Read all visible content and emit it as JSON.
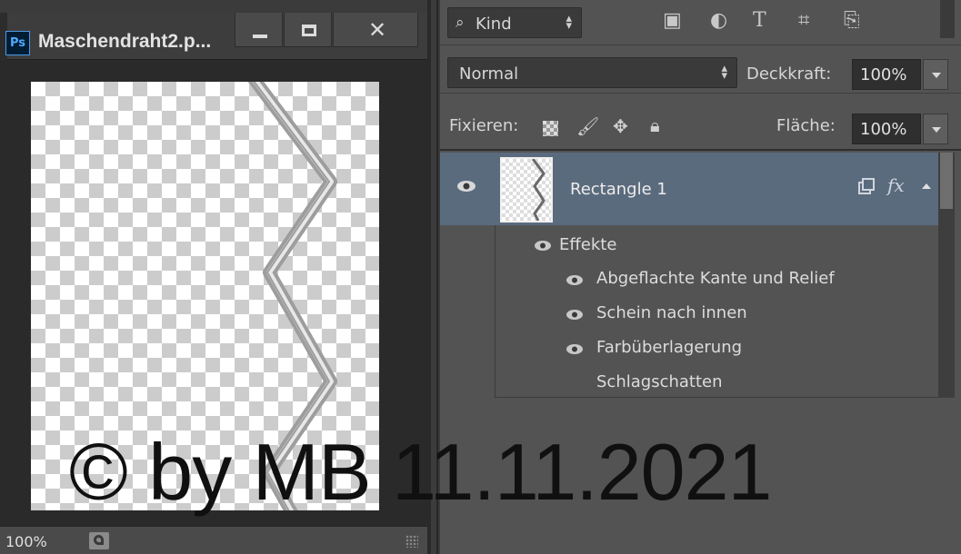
{
  "document": {
    "app_badge": "Ps",
    "title": "Maschendraht2.p...",
    "zoom": "100%"
  },
  "layers_panel": {
    "filter": {
      "kind_label": "Kind",
      "icons": [
        "pixel-layer-filter-icon",
        "adjustment-layer-filter-icon",
        "type-layer-filter-icon",
        "shape-layer-filter-icon",
        "smart-object-filter-icon"
      ]
    },
    "blend_mode": "Normal",
    "opacity_label": "Deckkraft:",
    "opacity_value": "100%",
    "lock_label": "Fixieren:",
    "fill_label": "Fläche:",
    "fill_value": "100%",
    "layer": {
      "name": "Rectangle 1",
      "fx_label": "fx"
    },
    "effects_label": "Effekte",
    "effects": [
      {
        "label": "Abgeflachte Kante und Relief",
        "visible": true
      },
      {
        "label": "Schein nach innen",
        "visible": true
      },
      {
        "label": "Farbüberlagerung",
        "visible": true
      },
      {
        "label": "Schlagschatten",
        "visible": false
      }
    ]
  },
  "watermark": "© by MB 11.11.2021",
  "colors": {
    "panel_bg": "#535353",
    "selected_layer": "#5b6b7e",
    "ps_badge": "#4fa9ff"
  }
}
